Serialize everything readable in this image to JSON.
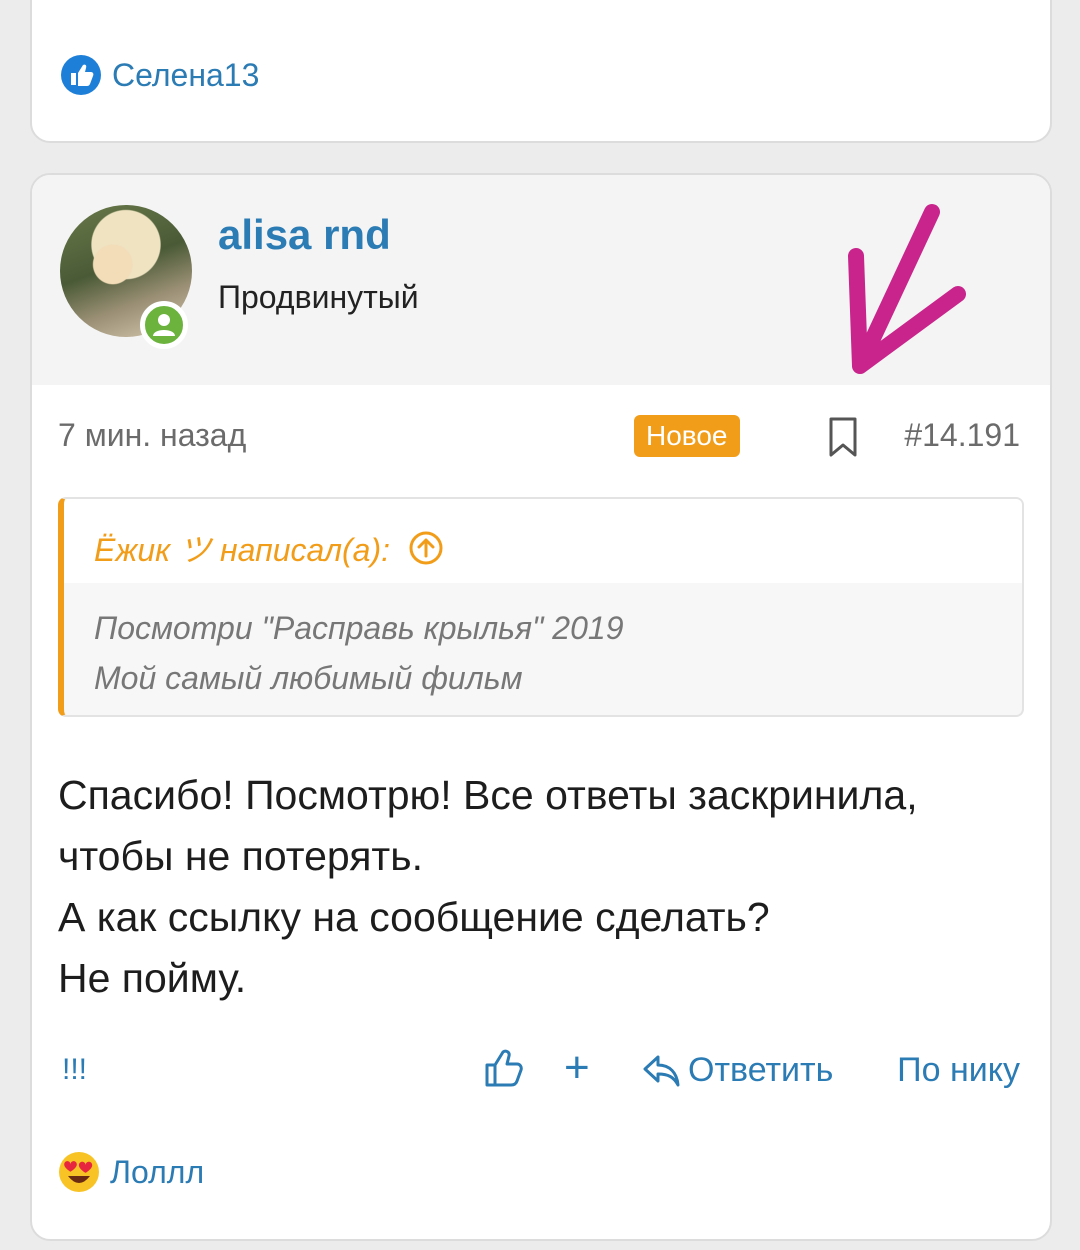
{
  "top_reaction": {
    "name": "Селена13",
    "icon": "thumbs-up-icon"
  },
  "post": {
    "author": "alisa rnd",
    "rank": "Продвинутый",
    "timestamp": "7 мин. назад",
    "new_badge": "Новое",
    "post_number": "#14.191",
    "quote": {
      "author_line": "Ёжик ツ написал(а):",
      "lines": [
        "Посмотри \"Расправь крылья\" 2019",
        "Мой самый любимый фильм"
      ]
    },
    "message_lines": [
      "Спасибо! Посмотрю! Все ответы заскринила,",
      "чтобы не потерять.",
      "А как ссылку на сообщение сделать?",
      "Не пойму."
    ],
    "actions": {
      "report": "!!!",
      "plus": "+",
      "reply": "Ответить",
      "by_nick": "По нику"
    },
    "reaction": {
      "name": "Лоллл",
      "icon": "heart-eyes-emoji-icon"
    }
  },
  "colors": {
    "accent": "#2b7bb4",
    "badge": "#f29d1a",
    "annotation_arrow": "#c8248c"
  }
}
